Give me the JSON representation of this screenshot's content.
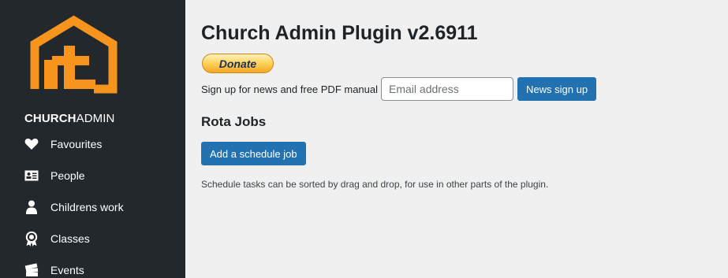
{
  "sidebar": {
    "brand_bold": "CHURCH",
    "brand_light": "ADMIN",
    "logo_color": "#f7941d",
    "items": [
      {
        "label": "Favourites",
        "icon": "heart-icon"
      },
      {
        "label": "People",
        "icon": "id-card-icon"
      },
      {
        "label": "Childrens work",
        "icon": "person-icon"
      },
      {
        "label": "Classes",
        "icon": "award-icon"
      },
      {
        "label": "Events",
        "icon": "tickets-icon"
      }
    ]
  },
  "main": {
    "title": "Church Admin Plugin v2.6911",
    "donate_label": "Donate",
    "signup": {
      "label": "Sign up for news and free PDF manual",
      "placeholder": "Email address",
      "button": "News sign up"
    },
    "section_title": "Rota Jobs",
    "add_job_button": "Add a schedule job",
    "help_text": "Schedule tasks can be sorted by drag and drop, for use in other parts of the plugin."
  },
  "colors": {
    "sidebar_bg": "#23282d",
    "primary": "#2271b1",
    "page_bg": "#f0f0f1"
  }
}
